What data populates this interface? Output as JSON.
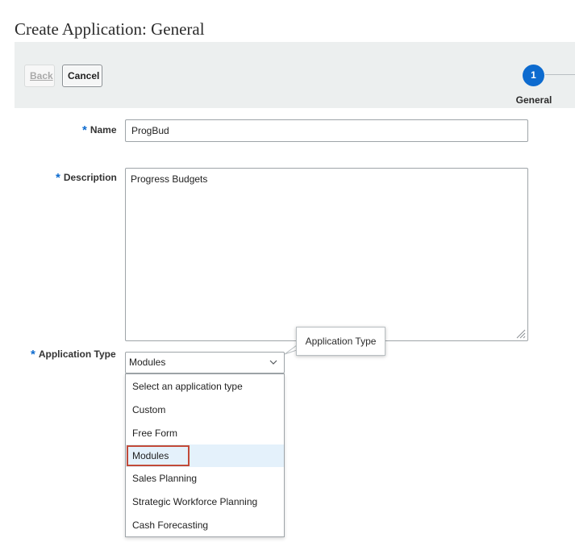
{
  "page": {
    "title": "Create Application: General"
  },
  "toolbar": {
    "back_label": "Back",
    "cancel_label": "Cancel"
  },
  "train": {
    "step_number": "1",
    "step_label": "General"
  },
  "form": {
    "required_marker": "*",
    "name": {
      "label": "Name",
      "value": "ProgBud"
    },
    "description": {
      "label": "Description",
      "value": "Progress Budgets"
    },
    "application_type": {
      "label": "Application Type",
      "value": "Modules",
      "tooltip": "Application Type",
      "options": [
        "Select an application type",
        "Custom",
        "Free Form",
        "Modules",
        "Sales Planning",
        "Strategic Workforce Planning",
        "Cash Forecasting"
      ],
      "highlighted_option": "Modules"
    }
  },
  "colors": {
    "accent": "#0d6bcf",
    "toolbar_bg": "#ecefef",
    "selected_option_bg": "#e4f1fb",
    "annotation_box": "#c24a38"
  },
  "icons": {
    "select_chevron": "chevron-down-icon",
    "textarea_grip": "resize-grip-icon"
  }
}
